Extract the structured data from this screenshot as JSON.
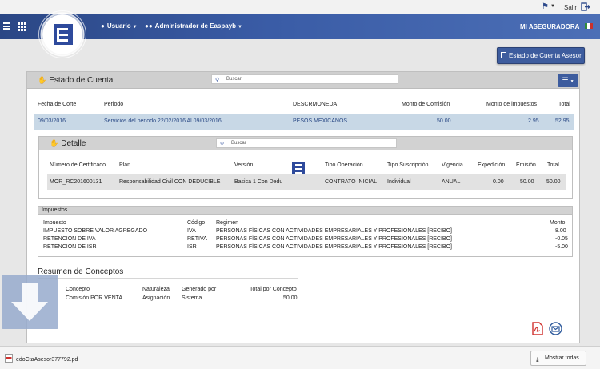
{
  "topbar": {
    "salir_label": "Salir"
  },
  "header": {
    "usuario_label": "Usuario",
    "admin_label": "Administrador de Easpayb",
    "brand_label": "MI ASEGURADORA"
  },
  "estado_button_label": "Estado de Cuenta Asesor",
  "panel": {
    "title": "Estado de Cuenta",
    "search_placeholder": "Buscar",
    "columns": {
      "fecha": "Fecha de Corte",
      "periodo": "Periodo",
      "moneda": "DESCRMONEDA",
      "comision": "Monto de Comisión",
      "impuestos": "Monto de impuestos",
      "total": "Total"
    },
    "row": {
      "fecha": "09/03/2016",
      "periodo": "Servicios del periodo 22/02/2016 Al 09/03/2016",
      "moneda": "PESOS MEXICANOS",
      "comision": "50.00",
      "impuestos": "2.95",
      "total": "52.95"
    }
  },
  "detalle": {
    "title": "Detalle",
    "search_placeholder": "Buscar",
    "columns": {
      "cert": "Número de Certificado",
      "plan": "Plan",
      "version": "Versión",
      "tipo_op": "Tipo Operación",
      "tipo_sus": "Tipo Suscripción",
      "vigencia": "Vigencia",
      "expedicion": "Expedición",
      "emision": "Emisión",
      "total": "Total"
    },
    "row": {
      "cert": "MOR_RC201600131",
      "plan": "Responsabilidad Civil CON DEDUCIBLE",
      "version": "Basica 1 Con Dedu",
      "tipo_op": "CONTRATO INICIAL",
      "tipo_sus": "Individual",
      "vigencia": "ANUAL",
      "expedicion": "0.00",
      "emision": "50.00",
      "total": "50.00"
    }
  },
  "impuestos": {
    "title": "Impuestos",
    "columns": {
      "impuesto": "Impuesto",
      "codigo": "Código",
      "regimen": "Regimen",
      "monto": "Monto"
    },
    "rows": [
      {
        "impuesto": "IMPUESTO SOBRE VALOR AGREGADO",
        "codigo": "IVA",
        "regimen": "PERSONAS FÍSICAS CON ACTIVIDADES EMPRESARIALES Y PROFESIONALES [RECIBO]",
        "monto": "8.00"
      },
      {
        "impuesto": "RETENCION DE IVA",
        "codigo": "RETIVA",
        "regimen": "PERSONAS FÍSICAS CON ACTIVIDADES EMPRESARIALES Y PROFESIONALES [RECIBO]",
        "monto": "-0.05"
      },
      {
        "impuesto": "RETENCION DE ISR",
        "codigo": "ISR",
        "regimen": "PERSONAS FÍSICAS CON ACTIVIDADES EMPRESARIALES Y PROFESIONALES [RECIBO]",
        "monto": "-5.00"
      }
    ]
  },
  "resumen": {
    "title": "Resumen de Conceptos",
    "columns": {
      "concepto": "Concepto",
      "naturaleza": "Naturaleza",
      "generado": "Generado por",
      "total": "Total por Concepto"
    },
    "row": {
      "concepto": "Comisión POR VENTA",
      "naturaleza": "Asignación",
      "generado": "Sistema",
      "total": "50.00"
    }
  },
  "downloads": {
    "filename": "edoCtaAsesor377792.pd",
    "show_all_label": "Mostrar todas"
  }
}
